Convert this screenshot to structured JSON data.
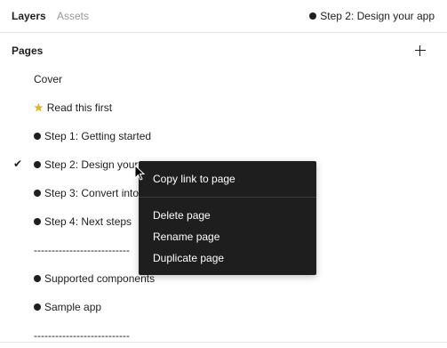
{
  "tabs": {
    "layers": "Layers",
    "assets": "Assets"
  },
  "current_page": "Step 2: Design your app",
  "pages_section": {
    "title": "Pages",
    "add_icon": "plus-icon"
  },
  "pages": [
    {
      "label": "Cover",
      "marker": "none",
      "checked": false
    },
    {
      "label": "Read this first",
      "marker": "star",
      "checked": false
    },
    {
      "label": "Step 1: Getting started",
      "marker": "dot",
      "checked": false
    },
    {
      "label": "Step 2: Design your",
      "marker": "dot",
      "checked": true
    },
    {
      "label": "Step 3: Convert into",
      "marker": "dot",
      "checked": false
    },
    {
      "label": "Step 4: Next steps",
      "marker": "dot",
      "checked": false
    },
    {
      "label": "---------------------------",
      "marker": "none",
      "checked": false
    },
    {
      "label": "Supported components",
      "marker": "dot",
      "checked": false
    },
    {
      "label": "Sample app",
      "marker": "dot",
      "checked": false
    },
    {
      "label": "---------------------------",
      "marker": "none",
      "checked": false
    }
  ],
  "check_glyph": "✔",
  "star_glyph": "★",
  "context_menu": {
    "copy_link": "Copy link to page",
    "delete": "Delete page",
    "rename": "Rename page",
    "duplicate": "Duplicate page"
  },
  "colors": {
    "menu_bg": "#1e1e1e",
    "star": "#f4b400",
    "muted_tab": "#9a9a9a"
  }
}
